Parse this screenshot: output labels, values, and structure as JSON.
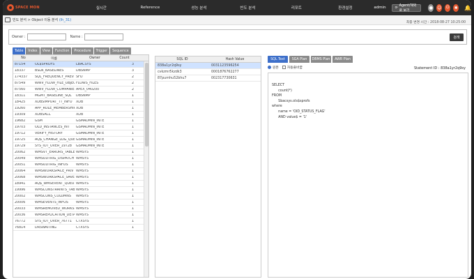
{
  "app": {
    "logo_text": "SPACE MON"
  },
  "nav": {
    "items": [
      "실시간",
      "Reference",
      "성능 분석",
      "빈도 분석",
      "리포트",
      "환경설정"
    ],
    "user": "admin",
    "agent_button": "Agent/해외로 보기"
  },
  "breadcrumb": {
    "path": "빈도 분석 > Object 이동 분석",
    "id": "(lh_31)"
  },
  "updated": "최종 변경 시간 : 2018-08-27 10:25:00",
  "search": {
    "owner_label": "Owner :",
    "owner_value": "",
    "name_label": "Name :",
    "name_value": "",
    "button": "검색"
  },
  "object_tabs": [
    {
      "label": "Table",
      "active": true
    },
    {
      "label": "Index",
      "active": false
    },
    {
      "label": "View",
      "active": false
    },
    {
      "label": "Function",
      "active": false
    },
    {
      "label": "Procedure",
      "active": false
    },
    {
      "label": "Trigger",
      "active": false
    },
    {
      "label": "Sequence",
      "active": false
    }
  ],
  "object_table": {
    "headers": [
      "No",
      "이름",
      "Owner",
      "Count"
    ],
    "rows": [
      [
        "87154",
        "OL$SPROFS",
        "LBACSYS",
        "3"
      ],
      [
        "18337",
        "BSLN_BASELINES",
        "DBSNMP",
        "3"
      ],
      [
        "174337",
        "SQL_FREQUENCY_PREV",
        "SFO",
        "2"
      ],
      [
        "87549",
        "WWV_FLOW_FILE_OBJECT",
        "FLOWS_FILES",
        "2"
      ],
      [
        "87560",
        "WWV_FLOW_COMPANIES",
        "APEX_040200",
        "2"
      ],
      [
        "18311",
        "MGMT_BASELINE_SQL",
        "DBSNMP",
        "1"
      ],
      [
        "18425",
        "XDBSIMPORT_TT_INFO",
        "XDB",
        "1"
      ],
      [
        "19260",
        "APP_ROLE_MEMBERSHIP",
        "XDB",
        "1"
      ],
      [
        "19309",
        "XDBSACL",
        "XDB",
        "1"
      ],
      [
        "19682",
        "GSM",
        "GSMADMIN_INTE",
        "1"
      ],
      [
        "19703",
        "OLD_INSTANCES_INT",
        "GSMADMIN_INTE",
        "1"
      ],
      [
        "19712",
        "VERIFY_HISTORY",
        "GSMADMIN_INTE",
        "1"
      ],
      [
        "19725",
        "AQ$_CHANGE_LOG_QUE",
        "GSMADMIN_INTE",
        "1"
      ],
      [
        "19729",
        "SYS_IOT_OVER_19728",
        "GSMADMIN_INTE",
        "1"
      ],
      [
        "20062",
        "WMSVT_ERRORS_TABLES",
        "WMSYS",
        "1"
      ],
      [
        "20049",
        "WMSUDTRIG_DISPATCH",
        "WMSYS",
        "1"
      ],
      [
        "20051",
        "WMSUDTRIG_INFOS",
        "WMSYS",
        "1"
      ],
      [
        "20064",
        "WMSWORKSPACE_PRIV",
        "WMSYS",
        "1"
      ],
      [
        "20068",
        "WMSWORKSPACE_SAVEP",
        "WMSYS",
        "1"
      ],
      [
        "18941",
        "AQ$_WMSEVENT_QUEUE",
        "WMSYS",
        "1"
      ],
      [
        "19996",
        "WMSCONSTRAINTS_TABLES",
        "WMSYS",
        "1"
      ],
      [
        "20002",
        "WMSCONS_COLUMNS",
        "WMSYS",
        "1"
      ],
      [
        "20006",
        "WMSEVENTS_INFOS",
        "WMSYS",
        "1"
      ],
      [
        "20033",
        "WMSREMOVED_WORKSP",
        "WMSYS",
        "1"
      ],
      [
        "20036",
        "WMSREPLICATION_DETAI",
        "WMSYS",
        "1"
      ],
      [
        "76772",
        "SYS_IOT_OVER_76771",
        "CTXSYS",
        "1"
      ],
      [
        "76814",
        "DRSWAITING",
        "CTXSYS",
        "1"
      ]
    ]
  },
  "sql_table": {
    "headers": [
      "SQL ID",
      "Hash Value"
    ],
    "rows": [
      [
        "838a1yr2q9sy",
        "0031123596254"
      ],
      [
        "cvkzmr5kzdk3",
        "0001876762277"
      ],
      [
        "87purnhu52bhu7",
        "002317730631"
      ]
    ]
  },
  "right_tabs": [
    {
      "label": "SQL Text",
      "active": true
    },
    {
      "label": "SGA Plan",
      "active": false
    },
    {
      "label": "DBMS Plan",
      "active": false
    },
    {
      "label": "AWR Plan",
      "active": false
    }
  ],
  "view_options": {
    "radio_label": "원본",
    "checkbox_label": "자동줄바꿈"
  },
  "statement_id": "Statement ID : 838a1yr2q9sy",
  "sql_text": "SELECT\n      count(*)\nFROM\n      Sbacsys.ols$sprofs\nwhere\n      name = 'OID_STATUS_FLAG'\n      AND value$ = '1'"
}
